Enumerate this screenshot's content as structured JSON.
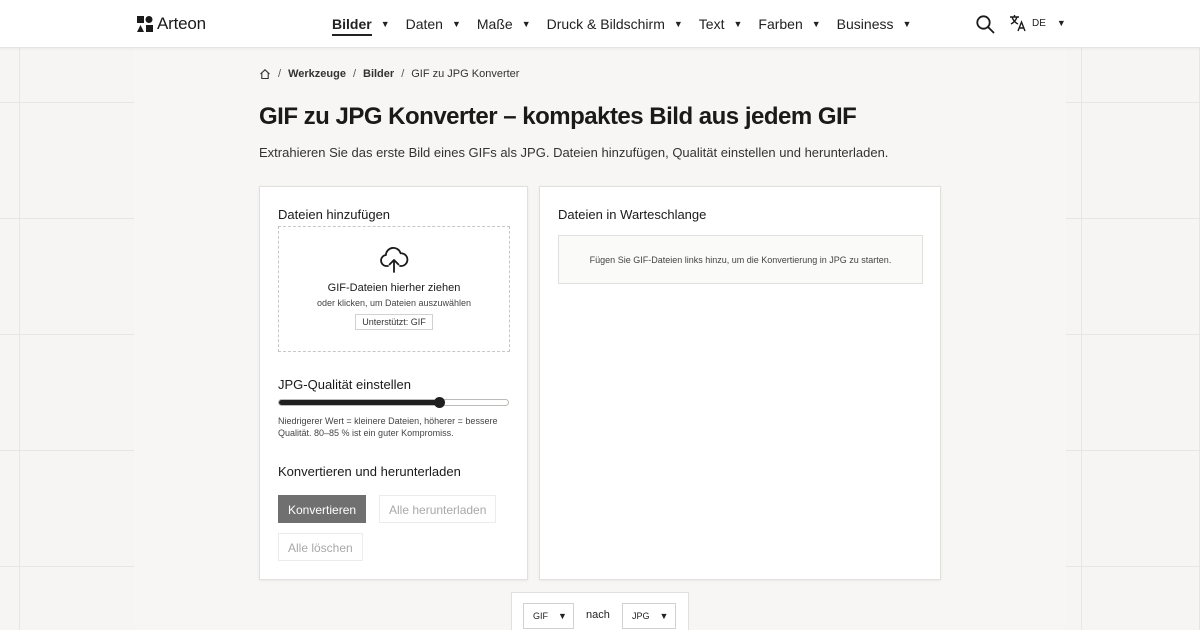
{
  "header": {
    "logo_text": "Arteon",
    "nav": [
      {
        "label": "Bilder",
        "active": true
      },
      {
        "label": "Daten"
      },
      {
        "label": "Maße"
      },
      {
        "label": "Druck & Bildschirm"
      },
      {
        "label": "Text"
      },
      {
        "label": "Farben"
      },
      {
        "label": "Business"
      }
    ],
    "nav_caret": "▼",
    "search_icon": "search-icon",
    "lang_icon": "translate-icon",
    "lang_code": "DE"
  },
  "breadcrumb": {
    "home_icon": "home-icon",
    "sep": "/",
    "items": [
      "Werkzeuge",
      "Bilder",
      "GIF zu JPG Konverter"
    ]
  },
  "page": {
    "title": "GIF zu JPG Konverter – kompaktes Bild aus jedem GIF",
    "subtitle": "Extrahieren Sie das erste Bild eines GIFs als JPG. Dateien hinzufügen, Qualität einstellen und herunterladen."
  },
  "upload": {
    "heading": "Dateien hinzufügen",
    "icon": "cloud-upload-icon",
    "drop_title": "GIF-Dateien hierher ziehen",
    "drop_sub": "oder klicken, um Dateien auszuwählen",
    "supports": "Unterstützt: GIF"
  },
  "quality": {
    "heading": "JPG-Qualität einstellen",
    "value_fraction": 0.7,
    "hint": "Niedrigerer Wert = kleinere Dateien, höherer = bessere Qualität. 80–85 % ist ein guter Kompromiss."
  },
  "actions": {
    "heading": "Konvertieren und herunterladen",
    "convert": "Konvertieren",
    "download_all": "Alle herunterladen",
    "clear_all": "Alle löschen"
  },
  "queue": {
    "heading": "Dateien in Warteschlange",
    "empty": "Fügen Sie GIF-Dateien links hinzu, um die Konvertierung in JPG zu starten."
  },
  "format": {
    "from": "GIF",
    "to": "JPG",
    "joiner": "nach",
    "caret": "▼"
  },
  "colors": {
    "primary_button": "#707070",
    "text": "#1f1f1f",
    "background": "#f6f5f3"
  }
}
